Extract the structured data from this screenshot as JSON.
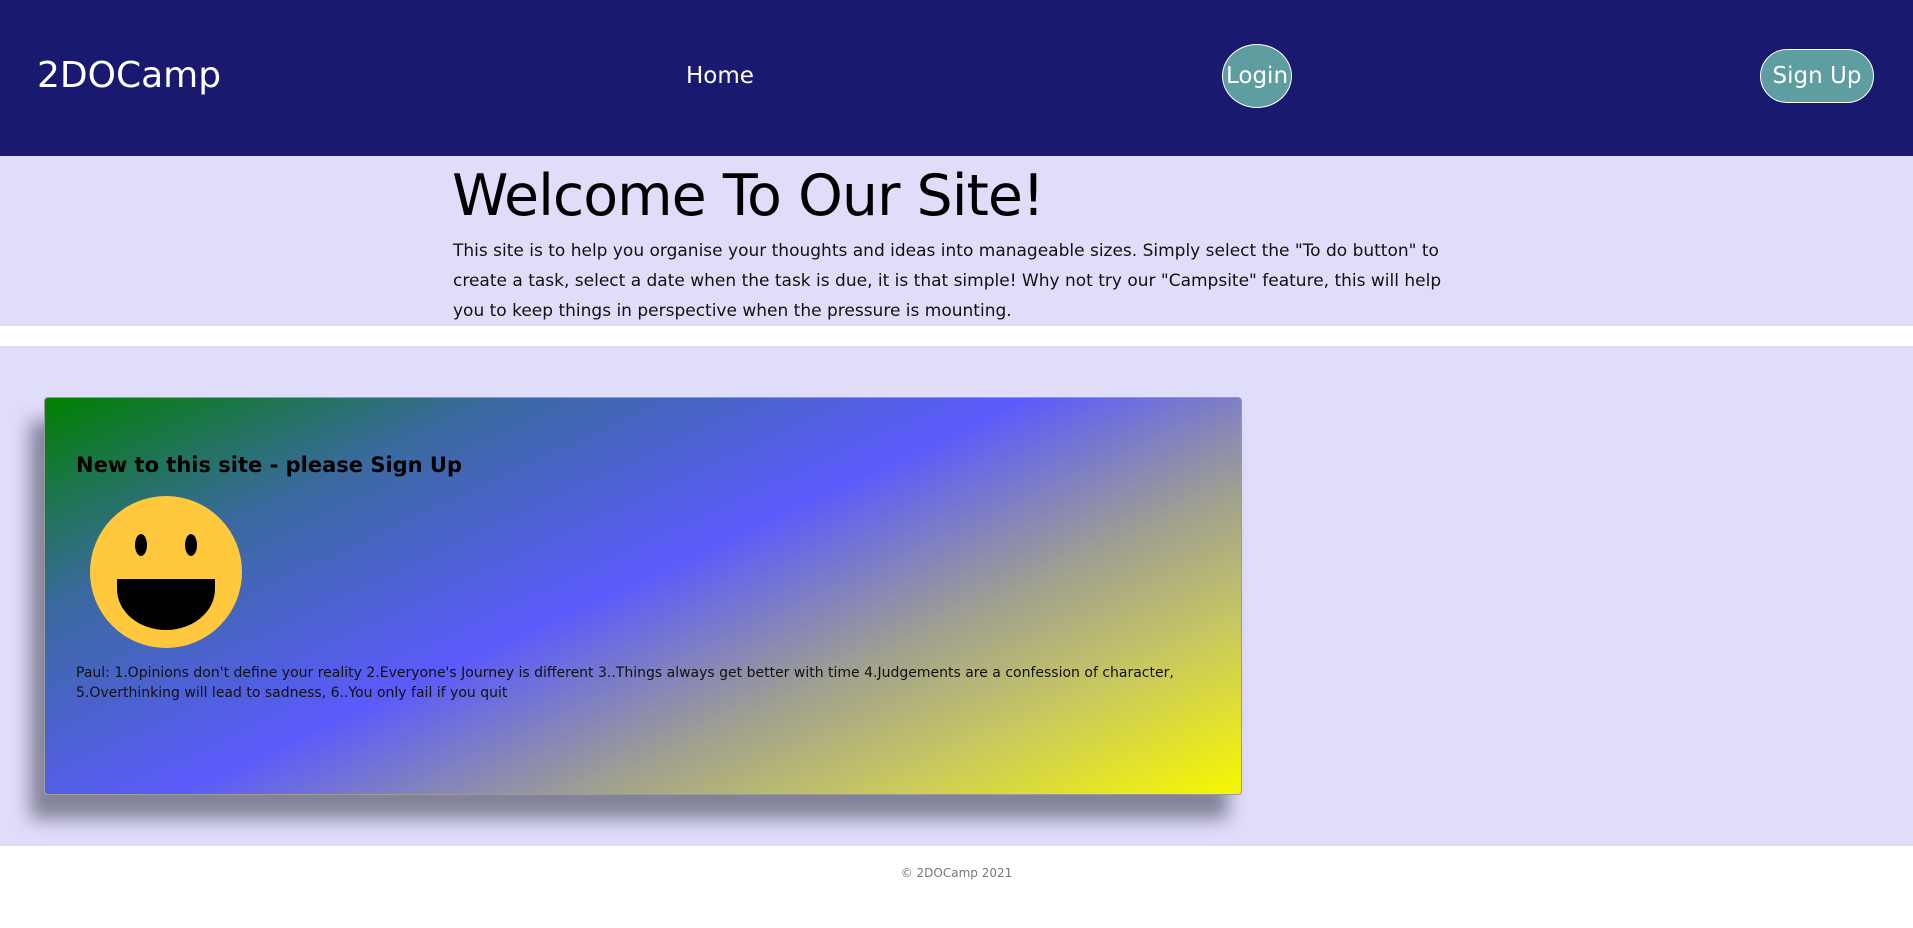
{
  "navbar": {
    "brand": "2DOCamp",
    "home_label": "Home",
    "login_label": "Login",
    "signup_label": "Sign Up"
  },
  "welcome": {
    "title": "Welcome To Our Site!",
    "text": "This site is to help you organise your thoughts and ideas into manageable sizes. Simply select the \"To do button\" to create a task, select a date when the task is due, it is that simple! Why not try our \"Campsite\" feature, this will help you to keep things in perspective when the pressure is mounting."
  },
  "card": {
    "title": "New to this site - please Sign Up",
    "image_icon": "smiley-face-icon",
    "text": "Paul: 1.Opinions don't define your reality 2.Everyone's Journey is different 3..Things always get better with time 4.Judgements are a confession of character, 5.Overthinking will lead to sadness, 6..You only fail if you quit"
  },
  "footer": {
    "copyright": "© 2DOCamp 2021"
  },
  "colors": {
    "navbar_bg": "#191970",
    "button_bg": "#5f9ea0",
    "band_bg": "#e0ddfb",
    "smiley_face": "#ffc83d"
  }
}
